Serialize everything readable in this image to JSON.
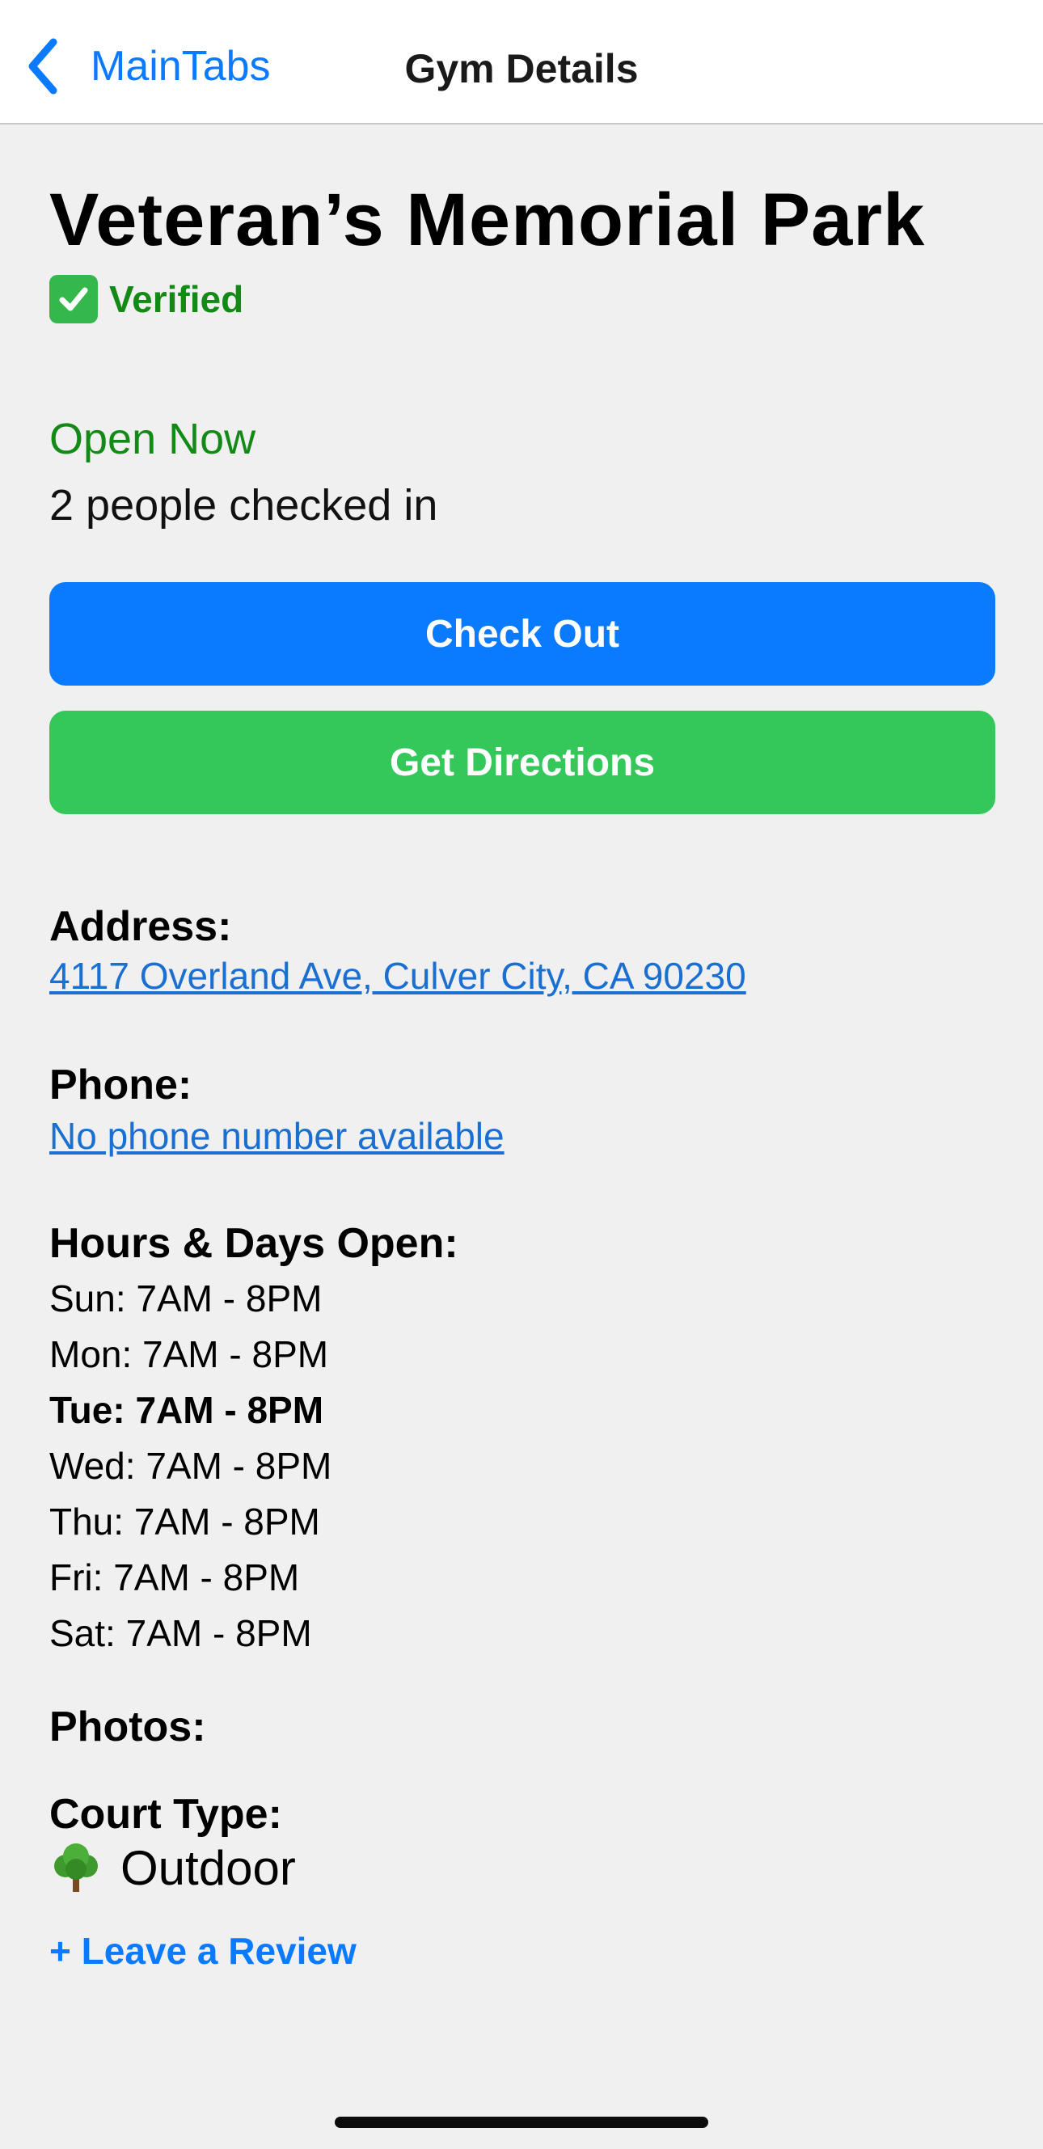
{
  "nav": {
    "back_label": "MainTabs",
    "title": "Gym Details"
  },
  "gym": {
    "name": "Veteran’s Memorial Park",
    "verified_label": "Verified",
    "status": "Open Now",
    "checked_in": "2 people checked in"
  },
  "actions": {
    "check_out": "Check Out",
    "get_directions": "Get Directions"
  },
  "address": {
    "label": "Address:",
    "value": "4117 Overland Ave, Culver City, CA 90230"
  },
  "phone": {
    "label": "Phone:",
    "value": "No phone number available"
  },
  "hours": {
    "label": "Hours & Days Open:",
    "days": [
      "Sun: 7AM - 8PM",
      "Mon: 7AM - 8PM",
      "Tue: 7AM - 8PM",
      "Wed: 7AM - 8PM",
      "Thu: 7AM - 8PM",
      "Fri: 7AM - 8PM",
      "Sat: 7AM - 8PM"
    ]
  },
  "photos": {
    "label": "Photos:"
  },
  "court": {
    "label": "Court Type:",
    "icon": "tree-icon",
    "value": "Outdoor"
  },
  "review": {
    "label": "+ Leave a Review"
  },
  "colors": {
    "accent_blue": "#0a7aff",
    "link_blue": "#1a6fd1",
    "success_green": "#34c759",
    "status_green": "#148a16"
  }
}
